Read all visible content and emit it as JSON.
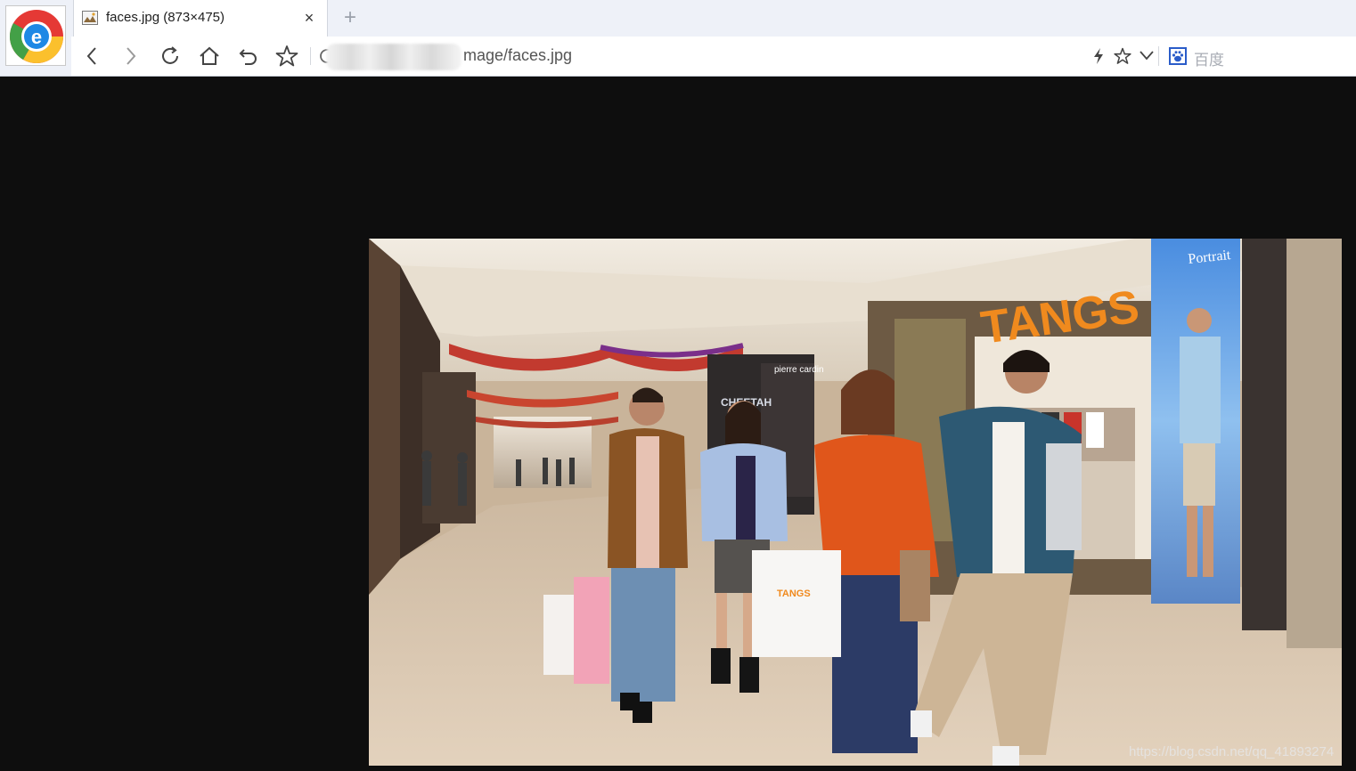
{
  "browser": {
    "logo_icon": "browser-logo-icon",
    "tab": {
      "title": "faces.jpg (873×475)",
      "favicon": "image-file-icon",
      "close_label": "×"
    },
    "new_tab_label": "+",
    "toolbar": {
      "back_icon": "chevron-left-icon",
      "forward_icon": "chevron-right-icon",
      "reload_icon": "reload-icon",
      "home_icon": "home-icon",
      "undo_icon": "undo-icon",
      "favorite_icon": "star-icon"
    },
    "address_bar": {
      "visible_url": "mage/faces.jpg",
      "blurred_prefix": true
    },
    "address_right_icons": [
      "lightning-icon",
      "star-icon",
      "chevron-down-icon"
    ],
    "search": {
      "engine_icon": "baidu-paw-icon",
      "placeholder": "百度"
    }
  },
  "viewer": {
    "background_color": "#0e0e0e",
    "image": {
      "description_icon": "photo-image",
      "store_sign": "TANGS",
      "poster_text": "Portrait",
      "bag_text": "TANGS",
      "left_store_text": "CHEETAH",
      "mid_store_text": "pierre cardin"
    },
    "watermark": "https://blog.csdn.net/qq_41893274"
  },
  "colors": {
    "chrome_bg": "#eef1f8",
    "tab_bg": "#ffffff",
    "store_sign_orange": "#f08a1e",
    "sweater_orange": "#e0561b"
  }
}
